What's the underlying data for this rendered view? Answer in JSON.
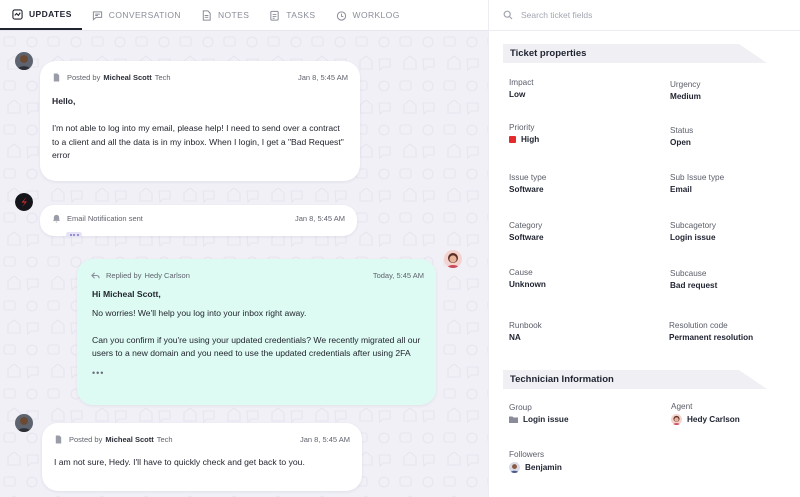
{
  "tabs": [
    {
      "label": "UPDATES",
      "icon": "updates-icon",
      "active": true
    },
    {
      "label": "CONVERSATION",
      "icon": "chat-icon"
    },
    {
      "label": "NOTES",
      "icon": "notes-icon"
    },
    {
      "label": "TASKS",
      "icon": "tasks-icon"
    },
    {
      "label": "WORKLOG",
      "icon": "clock-icon"
    }
  ],
  "messages": {
    "m1": {
      "posted_prefix": "Posted by",
      "author": "Micheal Scott",
      "role": "Tech",
      "time": "Jan 8, 5:45 AM",
      "greeting": "Hello,",
      "text": "I'm not able to log into my email, please help! I need to send over a contract to a client and all the data is in my inbox. When I login, I get a \"Bad Request\" error"
    },
    "notification": {
      "text": "Email Notifiication sent",
      "time": "Jan 8, 5:45 AM"
    },
    "reply": {
      "prefix": "Replied by",
      "author": "Hedy Carlson",
      "time": "Today, 5:45 AM",
      "greeting": "Hi Micheal Scott,",
      "p1": "No worries! We'll help you log into your inbox right away.",
      "p2": "Can you confirm if you're using your updated credentials? We recently migrated all our users to a new domain and you need to use the updated credentials after using 2FA",
      "more": "•••"
    },
    "m2": {
      "posted_prefix": "Posted by",
      "author": "Micheal Scott",
      "role": "Tech",
      "time": "Jan 8, 5:45 AM",
      "text": "I am not sure, Hedy. I'll have to quickly check and get back to you."
    }
  },
  "search": {
    "placeholder": "Search ticket fields"
  },
  "ticket_properties": {
    "title": "Ticket properties",
    "impact": {
      "label": "Impact",
      "value": "Low"
    },
    "urgency": {
      "label": "Urgency",
      "value": "Medium"
    },
    "priority": {
      "label": "Priority",
      "value": "High",
      "color": "#e42a2a"
    },
    "status": {
      "label": "Status",
      "value": "Open"
    },
    "issue_type": {
      "label": "Issue type",
      "value": "Software"
    },
    "sub_issue_type": {
      "label": "Sub Issue type",
      "value": "Email"
    },
    "category": {
      "label": "Category",
      "value": "Software"
    },
    "subcategory": {
      "label": "Subcagetory",
      "value": "Login issue"
    },
    "cause": {
      "label": "Cause",
      "value": "Unknown"
    },
    "subcause": {
      "label": "Subcause",
      "value": "Bad request"
    },
    "runbook": {
      "label": "Runbook",
      "value": "NA"
    },
    "resolution_code": {
      "label": "Resolution code",
      "value": "Permanent resolution"
    }
  },
  "technician": {
    "title": "Technician Information",
    "group": {
      "label": "Group",
      "value": "Login issue"
    },
    "agent": {
      "label": "Agent",
      "value": "Hedy Carlson"
    },
    "followers": {
      "label": "Followers",
      "value": "Benjamin"
    }
  },
  "colors": {
    "reply_bg": "#ddfbf3",
    "timeline_bg": "#f1f0f7",
    "brand_red": "#e42a2a"
  }
}
